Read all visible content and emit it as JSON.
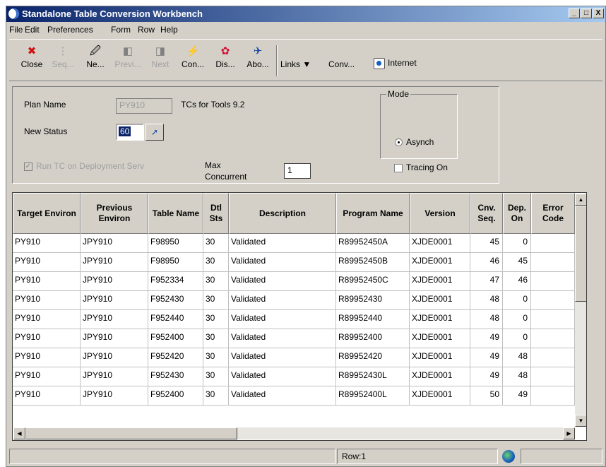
{
  "window": {
    "title": "Standalone Table Conversion Workbench",
    "controls": [
      "_",
      "□",
      "X"
    ]
  },
  "menu": [
    "File",
    "Edit",
    "Preferences",
    "Form",
    "Row",
    "Help"
  ],
  "toolbar": {
    "buttons": [
      {
        "label": "Close",
        "icon": "close-icon",
        "glyph": "✖",
        "enabled": true
      },
      {
        "label": "Seq...",
        "icon": "sequence-icon",
        "glyph": "⋮",
        "enabled": false
      },
      {
        "label": "Ne...",
        "icon": "new-icon",
        "glyph": "🖉",
        "enabled": true
      },
      {
        "label": "Previ...",
        "icon": "previous-icon",
        "glyph": "◧",
        "enabled": false
      },
      {
        "label": "Next",
        "icon": "next-icon",
        "glyph": "◨",
        "enabled": false
      },
      {
        "label": "Con...",
        "icon": "connect-icon",
        "glyph": "⚡",
        "enabled": true
      },
      {
        "label": "Dis...",
        "icon": "display-icon",
        "glyph": "✿",
        "enabled": true
      },
      {
        "label": "Abo...",
        "icon": "about-icon",
        "glyph": "✈",
        "enabled": true
      }
    ],
    "links_label": "Links",
    "conv_label": "Conv...",
    "internet_label": "Internet"
  },
  "form": {
    "plan_name_label": "Plan Name",
    "plan_name_value": "PY910",
    "plan_description": "TCs for Tools 9.2",
    "new_status_label": "New Status",
    "new_status_value": "60",
    "run_tc_label": "Run TC on Deployment Serv",
    "max_concurrent_label": "Max Concurrent",
    "max_concurrent_value": "1",
    "mode_label": "Mode",
    "mode_option": "Asynch",
    "tracing_label": "Tracing On"
  },
  "grid": {
    "columns": [
      "Target Environ",
      "Previous Environ",
      "Table Name",
      "Dtl Sts",
      "Description",
      "Program Name",
      "Version",
      "Cnv. Seq.",
      "Dep. On",
      "Error Code"
    ],
    "rows": [
      [
        "PY910",
        "JPY910",
        "F98950",
        "30",
        "Validated",
        "R89952450A",
        "XJDE0001",
        "45",
        "0",
        ""
      ],
      [
        "PY910",
        "JPY910",
        "F98950",
        "30",
        "Validated",
        "R89952450B",
        "XJDE0001",
        "46",
        "45",
        ""
      ],
      [
        "PY910",
        "JPY910",
        "F952334",
        "30",
        "Validated",
        "R89952450C",
        "XJDE0001",
        "47",
        "46",
        ""
      ],
      [
        "PY910",
        "JPY910",
        "F952430",
        "30",
        "Validated",
        "R89952430",
        "XJDE0001",
        "48",
        "0",
        ""
      ],
      [
        "PY910",
        "JPY910",
        "F952440",
        "30",
        "Validated",
        "R89952440",
        "XJDE0001",
        "48",
        "0",
        ""
      ],
      [
        "PY910",
        "JPY910",
        "F952400",
        "30",
        "Validated",
        "R89952400",
        "XJDE0001",
        "49",
        "0",
        ""
      ],
      [
        "PY910",
        "JPY910",
        "F952420",
        "30",
        "Validated",
        "R89952420",
        "XJDE0001",
        "49",
        "48",
        ""
      ],
      [
        "PY910",
        "JPY910",
        "F952430",
        "30",
        "Validated",
        "R89952430L",
        "XJDE0001",
        "49",
        "48",
        ""
      ],
      [
        "PY910",
        "JPY910",
        "F952400",
        "30",
        "Validated",
        "R89952400L",
        "XJDE0001",
        "50",
        "49",
        ""
      ]
    ]
  },
  "status": {
    "row_label": "Row:1"
  }
}
